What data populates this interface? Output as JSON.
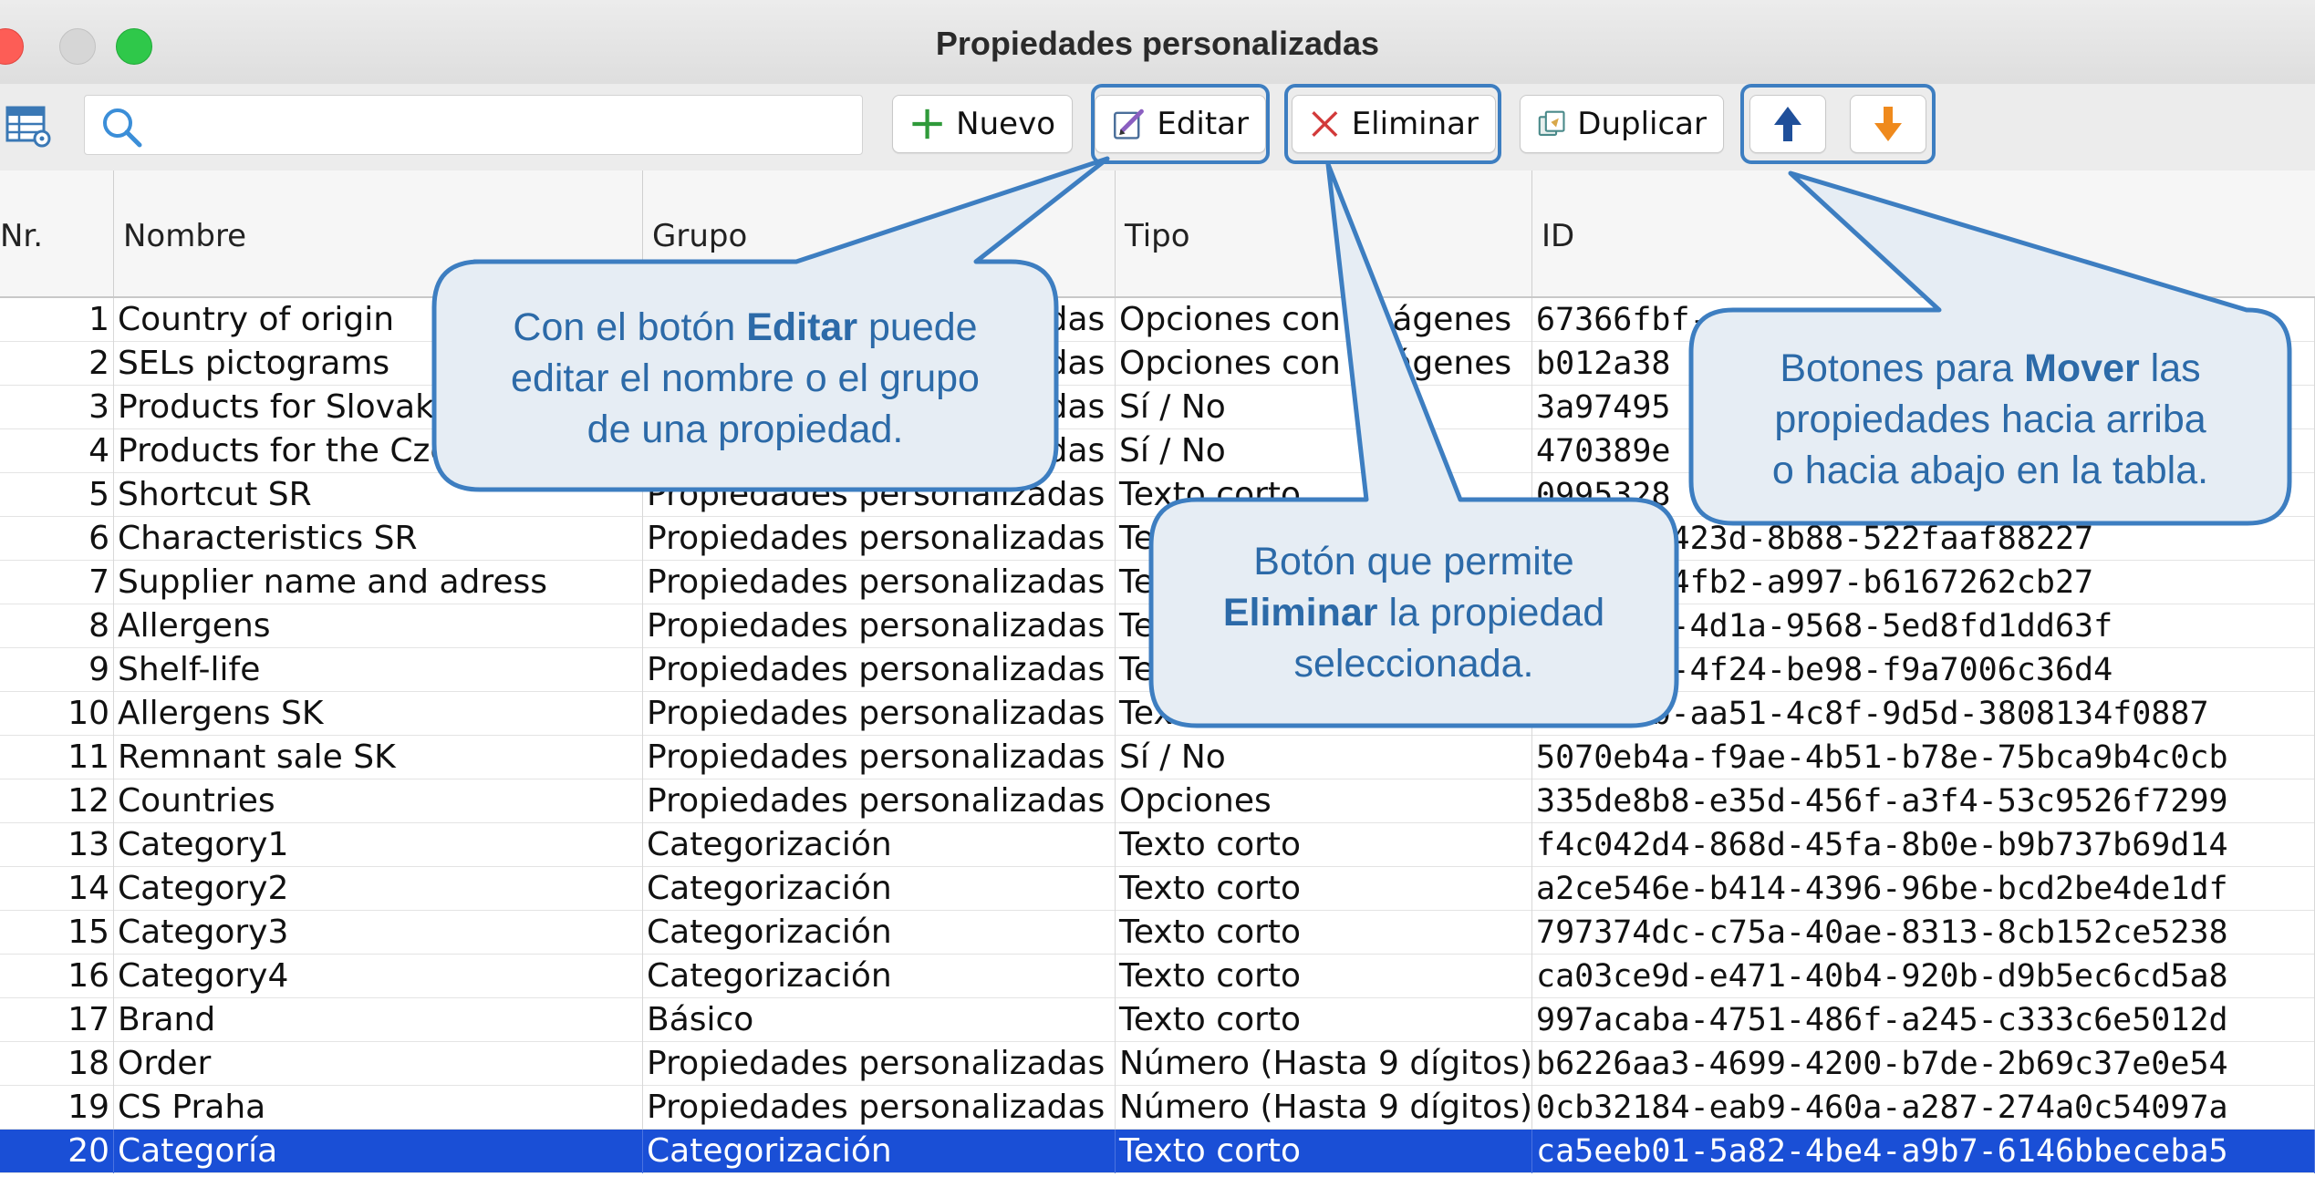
{
  "window": {
    "title": "Propiedades personalizadas"
  },
  "toolbar": {
    "table_settings_icon": "table-settings-icon",
    "search": {
      "value": "",
      "placeholder": ""
    },
    "buttons": {
      "nuevo": "Nuevo",
      "editar": "Editar",
      "eliminar": "Eliminar",
      "duplicar": "Duplicar"
    },
    "move_up_icon": "arrow-up-icon",
    "move_down_icon": "arrow-down-icon"
  },
  "colors": {
    "highlight_border": "#3d7ec1",
    "callout_fill": "#e6edf4",
    "callout_text": "#2c6aa8",
    "selected_row": "#1a4fd6",
    "arrow_up": "#1f4f9a",
    "arrow_down": "#ef8a1d"
  },
  "table": {
    "columns": [
      "Nr.",
      "Nombre",
      "Grupo",
      "Tipo",
      "ID"
    ],
    "selected_row": 20,
    "rows": [
      {
        "nr": "1",
        "nombre": "Country of origin",
        "grupo": "Propiedades personalizadas",
        "tipo": "Opciones con imágenes",
        "id": "67366fbf-"
      },
      {
        "nr": "2",
        "nombre": "SELs pictograms",
        "grupo": "Propiedades personalizadas",
        "tipo": "Opciones con imágenes",
        "id": "b012a38"
      },
      {
        "nr": "3",
        "nombre": "Products for Slovakia",
        "grupo": "Propiedades personalizadas",
        "tipo": "Sí / No",
        "id": "3a97495"
      },
      {
        "nr": "4",
        "nombre": "Products for the Czech",
        "grupo": "Propiedades personalizadas",
        "tipo": "Sí / No",
        "id": "470389e"
      },
      {
        "nr": "5",
        "nombre": "Shortcut SR",
        "grupo": "Propiedades personalizadas",
        "tipo": "Texto corto",
        "id": "0995328"
      },
      {
        "nr": "6",
        "nombre": "Characteristics SR",
        "grupo": "Propiedades personalizadas",
        "tipo": "Texto corto",
        "id": "2-f1c0-423d-8b88-522faaf88227"
      },
      {
        "nr": "7",
        "nombre": "Supplier name and adress",
        "grupo": "Propiedades personalizadas",
        "tipo": "Texto corto",
        "id": "5-d8de-4fb2-a997-b6167262cb27"
      },
      {
        "nr": "8",
        "nombre": "Allergens",
        "grupo": "Propiedades personalizadas",
        "tipo": "Texto corto",
        "id": "da-a4dc-4d1a-9568-5ed8fd1dd63f"
      },
      {
        "nr": "9",
        "nombre": "Shelf-life",
        "grupo": "Propiedades personalizadas",
        "tipo": "Texto corto",
        "id": "10-af36-4f24-be98-f9a7006c36d4"
      },
      {
        "nr": "10",
        "nombre": "Allergens SK",
        "grupo": "Propiedades personalizadas",
        "tipo": "Texto corto",
        "id": "4d4a31b-aa51-4c8f-9d5d-3808134f0887"
      },
      {
        "nr": "11",
        "nombre": "Remnant sale SK",
        "grupo": "Propiedades personalizadas",
        "tipo": "Sí / No",
        "id": "5070eb4a-f9ae-4b51-b78e-75bca9b4c0cb"
      },
      {
        "nr": "12",
        "nombre": "Countries",
        "grupo": "Propiedades personalizadas",
        "tipo": "Opciones",
        "id": "335de8b8-e35d-456f-a3f4-53c9526f7299"
      },
      {
        "nr": "13",
        "nombre": "Category1",
        "grupo": "Categorización",
        "tipo": "Texto corto",
        "id": "f4c042d4-868d-45fa-8b0e-b9b737b69d14"
      },
      {
        "nr": "14",
        "nombre": "Category2",
        "grupo": "Categorización",
        "tipo": "Texto corto",
        "id": "a2ce546e-b414-4396-96be-bcd2be4de1df"
      },
      {
        "nr": "15",
        "nombre": "Category3",
        "grupo": "Categorización",
        "tipo": "Texto corto",
        "id": "797374dc-c75a-40ae-8313-8cb152ce5238"
      },
      {
        "nr": "16",
        "nombre": "Category4",
        "grupo": "Categorización",
        "tipo": "Texto corto",
        "id": "ca03ce9d-e471-40b4-920b-d9b5ec6cd5a8"
      },
      {
        "nr": "17",
        "nombre": "Brand",
        "grupo": "Básico",
        "tipo": "Texto corto",
        "id": "997acaba-4751-486f-a245-c333c6e5012d"
      },
      {
        "nr": "18",
        "nombre": "Order",
        "grupo": "Propiedades personalizadas",
        "tipo": "Número (Hasta 9 dígitos)",
        "id": "b6226aa3-4699-4200-b7de-2b69c37e0e54"
      },
      {
        "nr": "19",
        "nombre": "CS Praha",
        "grupo": "Propiedades personalizadas",
        "tipo": "Número (Hasta 9 dígitos)",
        "id": "0cb32184-eab9-460a-a287-274a0c54097a"
      },
      {
        "nr": "20",
        "nombre": "Categoría",
        "grupo": "Categorización",
        "tipo": "Texto corto",
        "id": "ca5eeb01-5a82-4be4-a9b7-6146bbeceba5"
      }
    ]
  },
  "callouts": {
    "editar": {
      "line1_pre": "Con el botón ",
      "line1_bold": "Editar",
      "line1_post": " puede",
      "line2": "editar el nombre o el grupo",
      "line3": "de una propiedad."
    },
    "eliminar": {
      "line1": "Botón que permite",
      "line2_bold": "Eliminar",
      "line2_post": " la propiedad",
      "line3": "seleccionada."
    },
    "mover": {
      "line1_pre": "Botones para ",
      "line1_bold": "Mover",
      "line1_post": " las",
      "line2": "propiedades hacia arriba",
      "line3": "o hacia abajo en la tabla."
    }
  }
}
